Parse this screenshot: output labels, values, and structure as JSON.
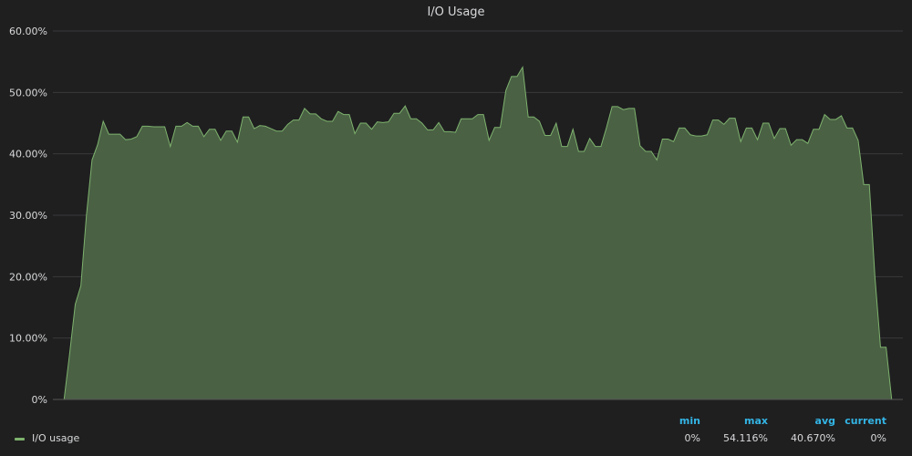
{
  "panel": {
    "title": "I/O Usage"
  },
  "legend": {
    "headers": {
      "min": "min",
      "max": "max",
      "avg": "avg",
      "current": "current"
    },
    "series": [
      {
        "name": "I/O usage",
        "min": "0%",
        "max": "54.116%",
        "avg": "40.670%",
        "current": "0%"
      }
    ]
  },
  "colors": {
    "background": "#1f1f20",
    "series_line": "#7eb26d",
    "series_fill": "#4a6144",
    "grid": "#3a3a3b",
    "legend_header": "#33b5e5"
  },
  "chart_data": {
    "type": "area",
    "title": "I/O Usage",
    "xlabel": "",
    "ylabel": "",
    "ylim": [
      0,
      60
    ],
    "yticks": [
      0,
      10,
      20,
      30,
      40,
      50,
      60
    ],
    "ytick_labels": [
      "0%",
      "10.00%",
      "20.00%",
      "30.00%",
      "40.00%",
      "50.00%",
      "60.00%"
    ],
    "grid": true,
    "legend_position": "bottom-left",
    "series": [
      {
        "name": "I/O usage",
        "values": [
          0,
          0,
          0,
          7.5,
          15.5,
          18.5,
          30,
          39,
          41.5,
          45.3,
          43.2,
          43.2,
          43.2,
          42.3,
          42.4,
          42.8,
          44.5,
          44.5,
          44.4,
          44.4,
          44.4,
          41.2,
          44.5,
          44.5,
          45.1,
          44.5,
          44.5,
          42.8,
          44,
          44,
          42.2,
          43.7,
          43.7,
          41.9,
          46,
          46,
          44.1,
          44.6,
          44.5,
          44.1,
          43.7,
          43.7,
          44.8,
          45.5,
          45.5,
          47.4,
          46.5,
          46.5,
          45.7,
          45.3,
          45.3,
          46.9,
          46.4,
          46.4,
          43.3,
          45,
          45,
          44,
          45.2,
          45.1,
          45.2,
          46.6,
          46.6,
          47.8,
          45.7,
          45.7,
          45,
          43.9,
          43.9,
          45.1,
          43.6,
          43.6,
          43.5,
          45.7,
          45.7,
          45.7,
          46.4,
          46.4,
          42.2,
          44.3,
          44.3,
          50.3,
          52.6,
          52.6,
          54.116,
          46,
          46,
          45.3,
          43,
          43,
          45,
          41.2,
          41.2,
          44,
          40.4,
          40.4,
          42.5,
          41.2,
          41.2,
          44.3,
          47.7,
          47.7,
          47.2,
          47.4,
          47.4,
          41.3,
          40.4,
          40.4,
          39,
          42.4,
          42.4,
          42,
          44.2,
          44.2,
          43.1,
          42.9,
          42.9,
          43.1,
          45.5,
          45.5,
          44.8,
          45.8,
          45.8,
          42,
          44.2,
          44.2,
          42.3,
          45,
          45,
          42.5,
          44.1,
          44.1,
          41.4,
          42.3,
          42.3,
          41.7,
          44,
          44,
          46.4,
          45.6,
          45.6,
          46.2,
          44.2,
          44.2,
          42.2,
          35,
          35,
          20,
          8.5,
          8.5,
          0,
          0,
          0
        ]
      }
    ]
  }
}
